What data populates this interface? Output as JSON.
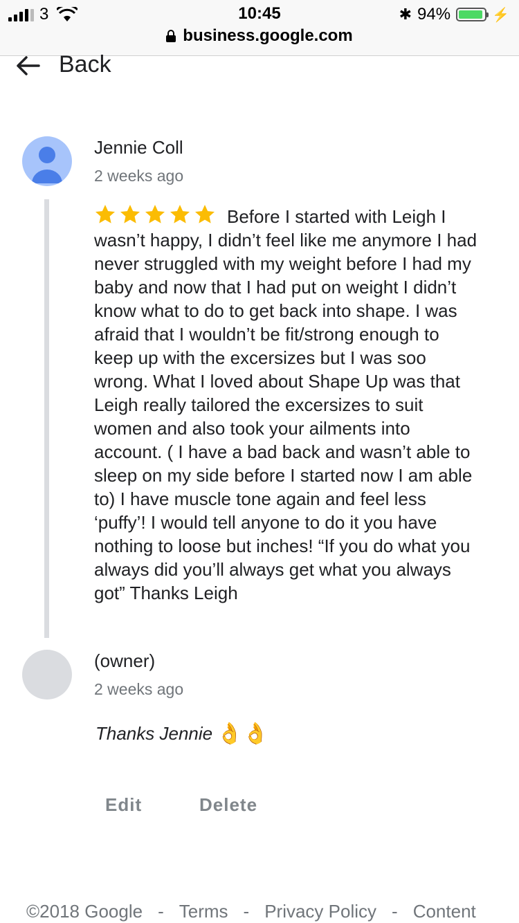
{
  "status_bar": {
    "carrier": "3",
    "time": "10:45",
    "battery_percent": "94%",
    "battery_level": 0.94,
    "url": "business.google.com"
  },
  "nav": {
    "back_label": "Back"
  },
  "review": {
    "reviewer_name": "Jennie Coll",
    "time_ago": "2 weeks ago",
    "rating": 5,
    "text": "Before I started with Leigh I wasn’t happy, I didn’t feel like me anymore I had never struggled with my weight before I had my baby and now that I had put on weight I didn’t know what to do to get back into shape. I was afraid that I wouldn’t be fit/strong enough to keep up with the excersizes but I was soo wrong. What I loved about Shape Up was that Leigh really tailored the excersizes to suit women and also took your ailments into account. ( I have a bad back and wasn’t able to sleep on my side before I started now I am able to) I have muscle tone again and feel less ‘puffy’! I would tell anyone to do it you have nothing to loose but inches! “If you do what you always did you’ll always get what you always got” Thanks Leigh",
    "star_color": "#fbbc04"
  },
  "reply": {
    "owner_label": "(owner)",
    "time_ago": "2 weeks ago",
    "text": "Thanks Jennie",
    "emoji": "👌👌"
  },
  "actions": {
    "edit": "Edit",
    "delete": "Delete"
  },
  "footer": {
    "copyright": "©2018 Google",
    "separator": "-",
    "terms": "Terms",
    "privacy": "Privacy Policy",
    "content": "Content"
  }
}
